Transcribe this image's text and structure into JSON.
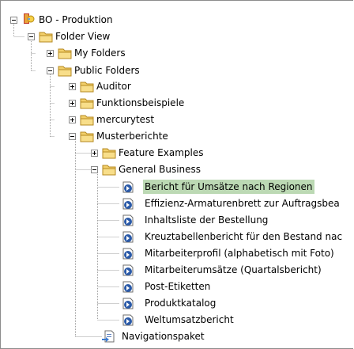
{
  "tree": {
    "root": {
      "label": "BO - Produktion",
      "expander": "minus",
      "icon": "bo-universe-icon"
    },
    "nodes": [
      {
        "label": "Folder View",
        "expander": "minus",
        "icon": "folder-icon"
      },
      {
        "label": "My Folders",
        "expander": "plus",
        "icon": "folder-icon"
      },
      {
        "label": "Public Folders",
        "expander": "minus",
        "icon": "folder-icon"
      },
      {
        "label": "Auditor",
        "expander": "plus",
        "icon": "folder-icon"
      },
      {
        "label": "Funktionsbeispiele",
        "expander": "plus",
        "icon": "folder-icon"
      },
      {
        "label": "mercurytest",
        "expander": "plus",
        "icon": "folder-icon"
      },
      {
        "label": "Musterberichte",
        "expander": "minus",
        "icon": "folder-icon"
      },
      {
        "label": "Feature Examples",
        "expander": "plus",
        "icon": "folder-icon"
      },
      {
        "label": "General Business",
        "expander": "minus",
        "icon": "folder-icon"
      },
      {
        "label": "Bericht für Umsätze nach Regionen",
        "expander": "none",
        "icon": "report-icon",
        "selected": true
      },
      {
        "label": "Effizienz-Armaturenbrett zur Auftragsbea",
        "expander": "none",
        "icon": "report-icon"
      },
      {
        "label": "Inhaltsliste der Bestellung",
        "expander": "none",
        "icon": "report-icon"
      },
      {
        "label": "Kreuztabellenbericht für den Bestand nac",
        "expander": "none",
        "icon": "report-icon"
      },
      {
        "label": "Mitarbeiterprofil (alphabetisch mit Foto)",
        "expander": "none",
        "icon": "report-icon"
      },
      {
        "label": "Mitarbeiterumsätze (Quartalsbericht)",
        "expander": "none",
        "icon": "report-icon"
      },
      {
        "label": "Post-Etiketten",
        "expander": "none",
        "icon": "report-icon"
      },
      {
        "label": "Produktkatalog",
        "expander": "none",
        "icon": "report-icon"
      },
      {
        "label": "Weltumsatzbericht",
        "expander": "none",
        "icon": "report-icon"
      },
      {
        "label": "Navigationspaket",
        "expander": "none",
        "icon": "navigation-package-icon"
      }
    ]
  },
  "colors": {
    "selection": "#bcd9b4",
    "folder": "#f2cf6a",
    "report_blue": "#2b5aa8",
    "tree_line": "#a0a0a0"
  }
}
